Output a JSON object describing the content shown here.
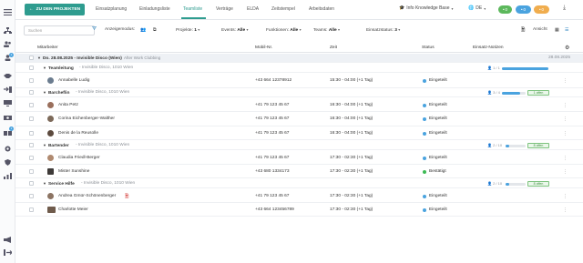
{
  "nav": {
    "back_label": "ZU DEN PROJEKTEN",
    "tabs": [
      "Einsatzplanung",
      "Einladungsliste",
      "Teamliste",
      "Verträge",
      "ELDA",
      "Zeitstempel",
      "Arbeitsdaten"
    ],
    "active_tab": "Teamliste",
    "knowledge_base": "Info Knowledge Base",
    "language": "DE",
    "pills": [
      {
        "label": "0",
        "color": "#5cb85c"
      },
      {
        "label": "0",
        "color": "#4aa3df"
      },
      {
        "label": "0",
        "color": "#f0ad4e"
      }
    ],
    "sidebar_badges": [
      "2",
      "1"
    ]
  },
  "filters": {
    "search_placeholder": "Suchen",
    "display_mode_label": "Anzeigemodus:",
    "projekte": {
      "label": "Projekte:",
      "value": "1"
    },
    "events": {
      "label": "Events:",
      "value": "Alle"
    },
    "funktionen": {
      "label": "Funktionen:",
      "value": "Alle"
    },
    "teams": {
      "label": "Teams:",
      "value": "Alle"
    },
    "einsatzstatus": {
      "label": "Einsatzstatus:",
      "value": "3"
    },
    "ansicht": "Ansicht"
  },
  "table": {
    "headers": {
      "mitarbeiter": "Mitarbeiter",
      "mobil": "Mobil-Nr.",
      "zeit": "Zeit",
      "status": "Status",
      "notizen": "Einsatz-Notizen"
    },
    "date_row": {
      "label": "Do. 28.08.2025 - Invisible Disco (Wien)",
      "sub": "After Work Clubbing",
      "date": "28.08.2025"
    },
    "groups": [
      {
        "name": "Teamleitung",
        "location": "Invisible Disco, 1010 Wien",
        "count": "1 / 1",
        "progress": 1.0,
        "offen": ""
      },
      {
        "name": "Barchef/in",
        "location": "Invisible Disco, 1010 Wien",
        "count": "3 / 4",
        "progress": 0.75,
        "offen": "1 offen"
      },
      {
        "name": "Bartender",
        "location": "Invisible Disco, 1010 Wien",
        "count": "2 / 10",
        "progress": 0.2,
        "offen": "8 offen"
      },
      {
        "name": "Service Hilfe",
        "location": "Invisible Disco, 1010 Wien",
        "count": "2 / 10",
        "progress": 0.2,
        "offen": "8 offen"
      }
    ],
    "rows": [
      {
        "name": "Annabelle Ludig",
        "mobile": "+43 664 12378912",
        "time": "15:30 - 04:00 (+1 Tag)",
        "status": "Eingeteilt",
        "status_color": "#4aa3df"
      },
      {
        "name": "Anita Petz",
        "mobile": "+41 79 123 45 67",
        "time": "16:30 - 04:00 (+1 Tag)",
        "status": "Eingeteilt",
        "status_color": "#4aa3df"
      },
      {
        "name": "Corina Eichenberger-Walther",
        "mobile": "+41 79 123 45 67",
        "time": "16:30 - 04:00 (+1 Tag)",
        "status": "Eingeteilt",
        "status_color": "#4aa3df"
      },
      {
        "name": "Denis de la Reusolle",
        "mobile": "+41 79 123 45 67",
        "time": "16:30 - 04:00 (+1 Tag)",
        "status": "Eingeteilt",
        "status_color": "#4aa3df"
      },
      {
        "name": "Claudia Friedl-Berger",
        "mobile": "+41 79 123 45 67",
        "time": "17:30 - 02:30 (+1 Tag)",
        "status": "Eingeteilt",
        "status_color": "#4aa3df"
      },
      {
        "name": "Mister Sunshine",
        "mobile": "+43 680 1334173",
        "time": "17:30 - 02:30 (+1 Tag)",
        "status": "Bestätigt",
        "status_color": "#3cba54"
      },
      {
        "name": "Andrea Gmür-Schönenberger",
        "mobile": "+41 79 123 45 67",
        "time": "17:30 - 02:30 (+1 Tag)",
        "status": "Eingeteilt",
        "status_color": "#4aa3df"
      },
      {
        "name": "Charlotte Meier",
        "mobile": "+43 664 123456789",
        "time": "17:30 - 02:30 (+1 Tag)",
        "status": "Eingeteilt",
        "status_color": "#4aa3df"
      }
    ]
  }
}
